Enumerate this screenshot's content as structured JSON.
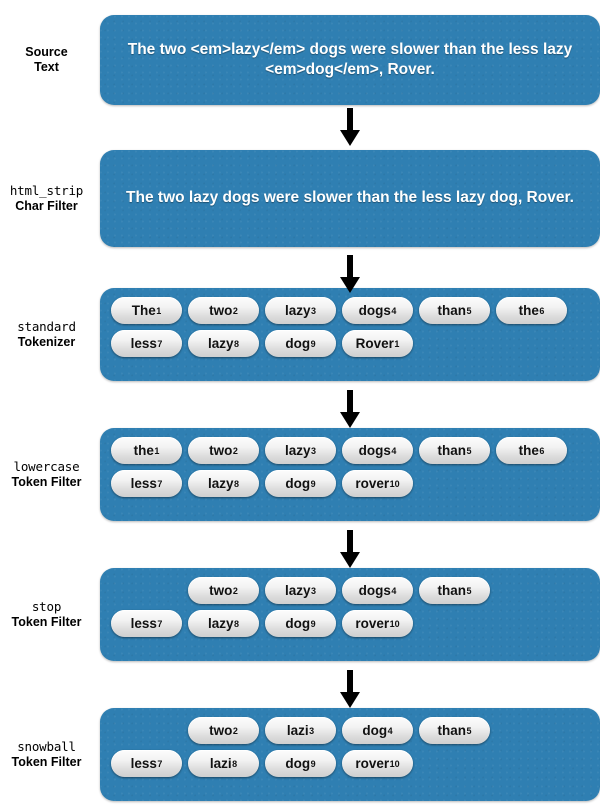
{
  "diagram": {
    "title": "Analysis chain: source text through char filter, tokenizer and token filters",
    "accent_color": "#2f7fb2",
    "token_color": "#e9e9e9",
    "arrow_color": "#000000"
  },
  "stages": [
    {
      "id": "source-text",
      "label_mono": "",
      "label_line1": "Source",
      "label_line2": "Text",
      "type": "text",
      "text": "The two <em>lazy</em> dogs were slower than the less lazy <em>dog</em>, Rover."
    },
    {
      "id": "html-strip-char-filter",
      "label_mono": "html_strip",
      "label_line2": "Char Filter",
      "type": "text",
      "text": "The two lazy dogs were slower than the less lazy dog, Rover."
    },
    {
      "id": "standard-tokenizer",
      "label_mono": "standard",
      "label_line2": "Tokenizer",
      "type": "tokens",
      "rows": [
        [
          {
            "text": "The",
            "pos": "1"
          },
          {
            "text": "two",
            "pos": "2"
          },
          {
            "text": "lazy",
            "pos": "3"
          },
          {
            "text": "dogs",
            "pos": "4"
          },
          {
            "text": "than",
            "pos": "5"
          },
          {
            "text": "the",
            "pos": "6"
          }
        ],
        [
          {
            "text": "less",
            "pos": "7"
          },
          {
            "text": "lazy",
            "pos": "8"
          },
          {
            "text": "dog",
            "pos": "9"
          },
          {
            "text": "Rover",
            "pos": "1"
          }
        ]
      ]
    },
    {
      "id": "lowercase-token-filter",
      "label_mono": "lowercase",
      "label_line2": "Token Filter",
      "type": "tokens",
      "rows": [
        [
          {
            "text": "the",
            "pos": "1"
          },
          {
            "text": "two",
            "pos": "2"
          },
          {
            "text": "lazy",
            "pos": "3"
          },
          {
            "text": "dogs",
            "pos": "4"
          },
          {
            "text": "than",
            "pos": "5"
          },
          {
            "text": "the",
            "pos": "6"
          }
        ],
        [
          {
            "text": "less",
            "pos": "7"
          },
          {
            "text": "lazy",
            "pos": "8"
          },
          {
            "text": "dog",
            "pos": "9"
          },
          {
            "text": "rover",
            "pos": "10"
          }
        ]
      ]
    },
    {
      "id": "stop-token-filter",
      "label_mono": "stop",
      "label_line2": "Token Filter",
      "type": "tokens",
      "rows": [
        [
          {
            "text": "",
            "pos": "",
            "empty": true
          },
          {
            "text": "two",
            "pos": "2"
          },
          {
            "text": "lazy",
            "pos": "3"
          },
          {
            "text": "dogs",
            "pos": "4"
          },
          {
            "text": "than",
            "pos": "5"
          }
        ],
        [
          {
            "text": "less",
            "pos": "7"
          },
          {
            "text": "lazy",
            "pos": "8"
          },
          {
            "text": "dog",
            "pos": "9"
          },
          {
            "text": "rover",
            "pos": "10"
          }
        ]
      ]
    },
    {
      "id": "snowball-token-filter",
      "label_mono": "snowball",
      "label_line2": "Token Filter",
      "type": "tokens",
      "rows": [
        [
          {
            "text": "",
            "pos": "",
            "empty": true
          },
          {
            "text": "two",
            "pos": "2"
          },
          {
            "text": "lazi",
            "pos": "3"
          },
          {
            "text": "dog",
            "pos": "4"
          },
          {
            "text": "than",
            "pos": "5"
          }
        ],
        [
          {
            "text": "less",
            "pos": "7"
          },
          {
            "text": "lazi",
            "pos": "8"
          },
          {
            "text": "dog",
            "pos": "9"
          },
          {
            "text": "rover",
            "pos": "10"
          }
        ]
      ]
    }
  ],
  "arrows": [
    {
      "id": "arrow-1",
      "from": "source-text",
      "to": "html-strip-char-filter"
    },
    {
      "id": "arrow-2",
      "from": "html-strip-char-filter",
      "to": "standard-tokenizer"
    },
    {
      "id": "arrow-3",
      "from": "standard-tokenizer",
      "to": "lowercase-token-filter"
    },
    {
      "id": "arrow-4",
      "from": "lowercase-token-filter",
      "to": "stop-token-filter"
    },
    {
      "id": "arrow-5",
      "from": "stop-token-filter",
      "to": "snowball-token-filter"
    }
  ]
}
